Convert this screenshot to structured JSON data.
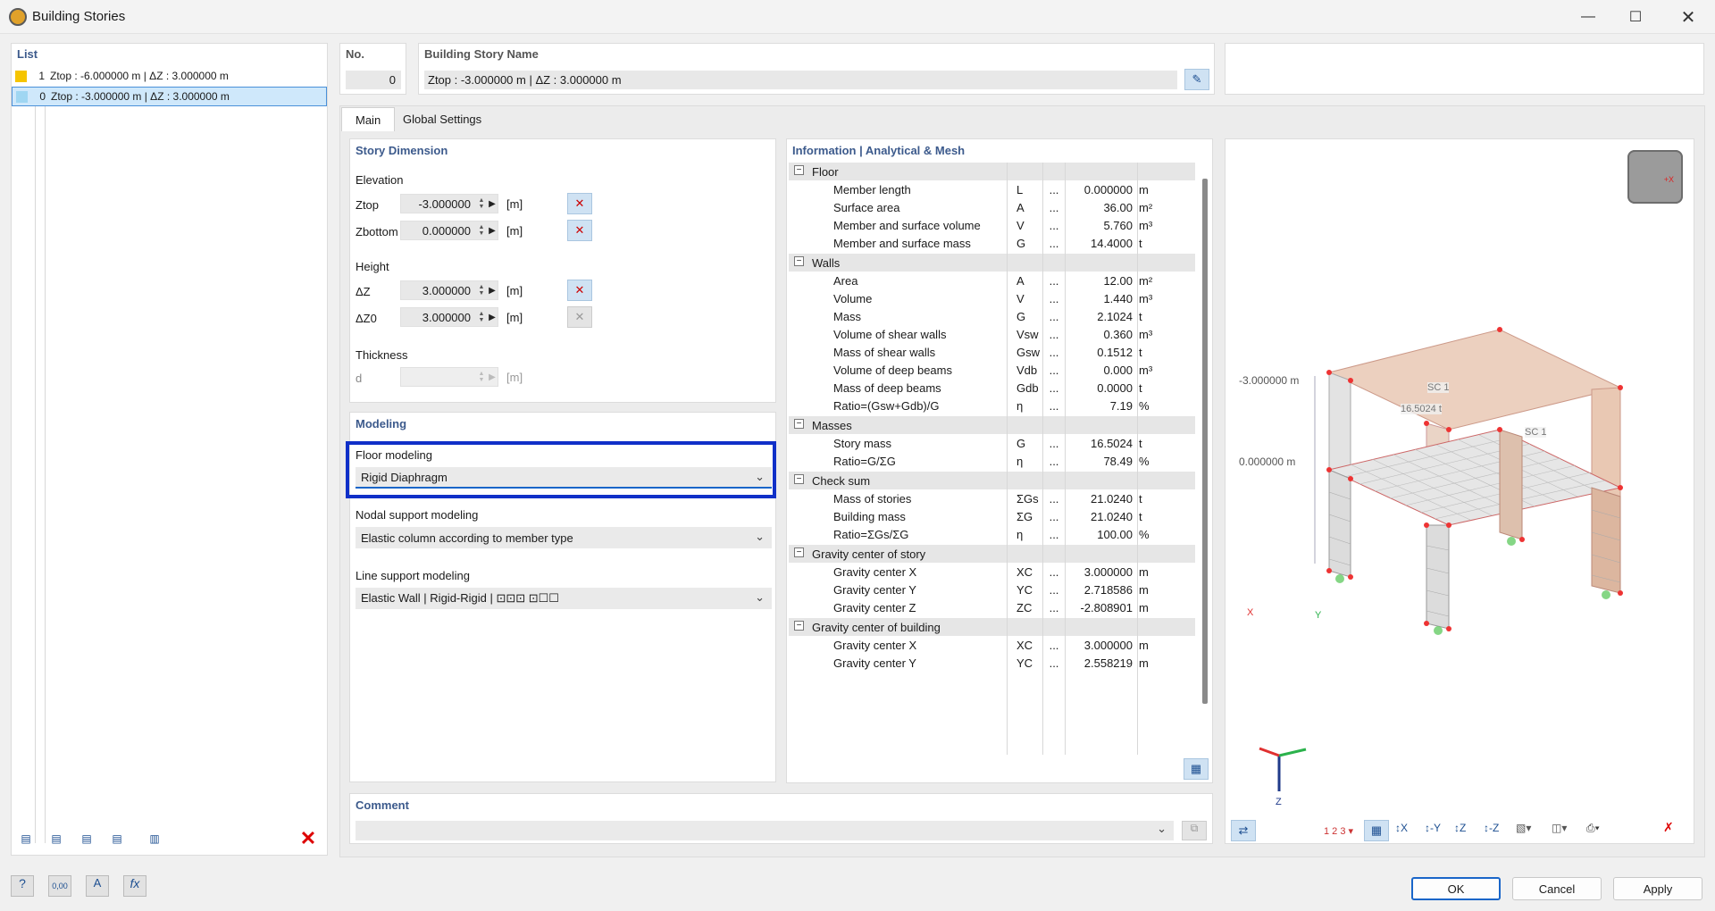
{
  "window": {
    "title": "Building Stories"
  },
  "list": {
    "header": "List",
    "items": [
      {
        "no": "1",
        "label": "Ztop : -6.000000 m | ΔZ : 3.000000 m",
        "color": "#f5c400"
      },
      {
        "no": "0",
        "label": "Ztop : -3.000000 m | ΔZ : 3.000000 m",
        "color": "#9fd6f2"
      }
    ]
  },
  "header": {
    "no_label": "No.",
    "no_value": "0",
    "name_label": "Building Story Name",
    "name_value": "Ztop : -3.000000 m | ΔZ : 3.000000 m"
  },
  "tabs": [
    "Main",
    "Global Settings"
  ],
  "story_dimension": {
    "header": "Story Dimension",
    "elevation_label": "Elevation",
    "ztop_label": "Ztop",
    "ztop_value": "-3.000000",
    "ztop_unit": "[m]",
    "zbottom_label": "Zbottom",
    "zbottom_value": "0.000000",
    "zbottom_unit": "[m]",
    "height_label": "Height",
    "dz_label": "ΔZ",
    "dz_value": "3.000000",
    "dz_unit": "[m]",
    "dz0_label": "ΔZ0",
    "dz0_value": "3.000000",
    "dz0_unit": "[m]",
    "thickness_label": "Thickness",
    "d_label": "d",
    "d_value": "",
    "d_unit": "[m]"
  },
  "modeling": {
    "header": "Modeling",
    "floor_label": "Floor modeling",
    "floor_value": "Rigid Diaphragm",
    "nodal_label": "Nodal support modeling",
    "nodal_value": "Elastic column according to member type",
    "line_label": "Line support modeling",
    "line_value": "Elastic Wall | Rigid-Rigid | ⊡⊡⊡ ⊡☐☐"
  },
  "info": {
    "header": "Information | Analytical & Mesh",
    "groups": [
      {
        "title": "Floor",
        "rows": [
          [
            "Member length",
            "L",
            "0.000000",
            "m"
          ],
          [
            "Surface area",
            "A",
            "36.00",
            "m²"
          ],
          [
            "Member and surface volume",
            "V",
            "5.760",
            "m³"
          ],
          [
            "Member and surface mass",
            "G",
            "14.4000",
            "t"
          ]
        ]
      },
      {
        "title": "Walls",
        "rows": [
          [
            "Area",
            "A",
            "12.00",
            "m²"
          ],
          [
            "Volume",
            "V",
            "1.440",
            "m³"
          ],
          [
            "Mass",
            "G",
            "2.1024",
            "t"
          ],
          [
            "Volume of shear walls",
            "Vsw",
            "0.360",
            "m³"
          ],
          [
            "Mass of shear walls",
            "Gsw",
            "0.1512",
            "t"
          ],
          [
            "Volume of deep beams",
            "Vdb",
            "0.000",
            "m³"
          ],
          [
            "Mass of deep beams",
            "Gdb",
            "0.0000",
            "t"
          ],
          [
            "Ratio=(Gsw+Gdb)/G",
            "η",
            "7.19",
            "%"
          ]
        ]
      },
      {
        "title": "Masses",
        "rows": [
          [
            "Story mass",
            "G",
            "16.5024",
            "t"
          ],
          [
            "Ratio=G/ΣG",
            "η",
            "78.49",
            "%"
          ]
        ]
      },
      {
        "title": "Check sum",
        "rows": [
          [
            "Mass of stories",
            "ΣGs",
            "21.0240",
            "t"
          ],
          [
            "Building mass",
            "ΣG",
            "21.0240",
            "t"
          ],
          [
            "Ratio=ΣGs/ΣG",
            "η",
            "100.00",
            "%"
          ]
        ]
      },
      {
        "title": "Gravity center of story",
        "rows": [
          [
            "Gravity center X",
            "XC",
            "3.000000",
            "m"
          ],
          [
            "Gravity center Y",
            "YC",
            "2.718586",
            "m"
          ],
          [
            "Gravity center Z",
            "ZC",
            "-2.808901",
            "m"
          ]
        ]
      },
      {
        "title": "Gravity center of building",
        "rows": [
          [
            "Gravity center X",
            "XC",
            "3.000000",
            "m"
          ],
          [
            "Gravity center Y",
            "YC",
            "2.558219",
            "m"
          ]
        ]
      }
    ],
    "ellipsis": "..."
  },
  "view3d": {
    "label_top": "-3.000000 m",
    "label_bottom": "0.000000 m",
    "sc1": "SC 1",
    "mass_label": "16.5024 t",
    "axis_x": "X",
    "axis_y": "Y",
    "axis_z": "Z"
  },
  "comment": {
    "header": "Comment",
    "value": ""
  },
  "buttons": {
    "ok": "OK",
    "cancel": "Cancel",
    "apply": "Apply"
  },
  "bottom_tools": {
    "number_format": "0,00"
  }
}
